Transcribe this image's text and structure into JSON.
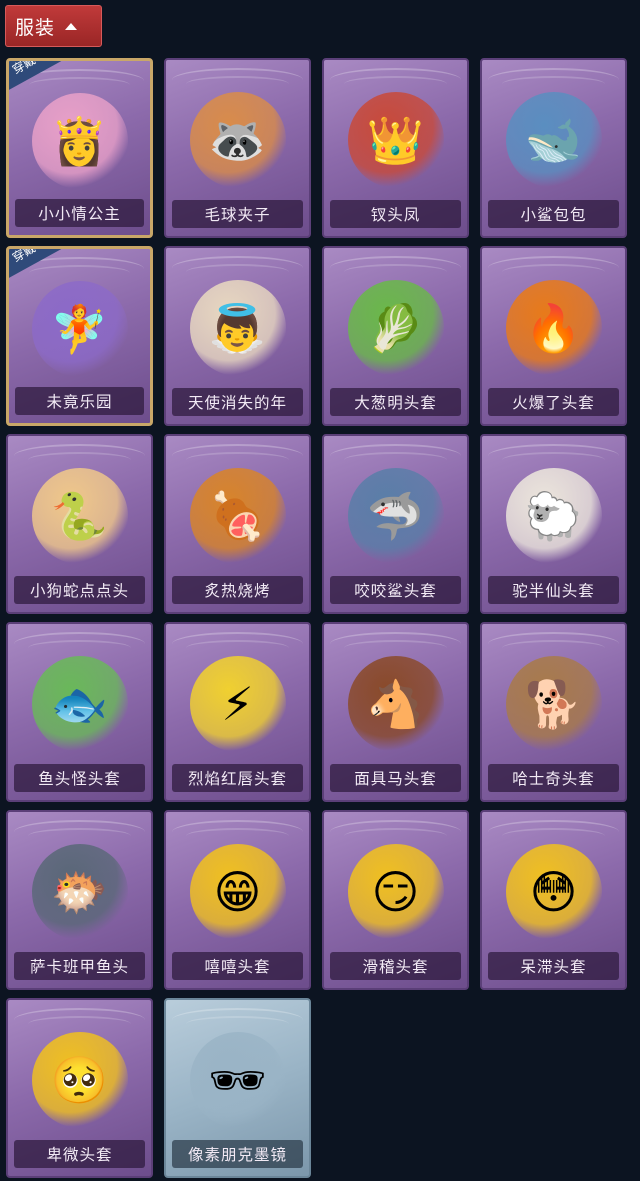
{
  "header": {
    "label": "服装"
  },
  "badge_text": "穿戴",
  "items": [
    {
      "name": "小小情公主",
      "equipped": true,
      "icon": "princess-figure-icon",
      "glyph": "👸",
      "bg": "#e8a0c8",
      "style": "purple"
    },
    {
      "name": "毛球夹子",
      "equipped": false,
      "icon": "raccoon-drummer-icon",
      "glyph": "🦝",
      "bg": "#d98c4a",
      "style": "purple"
    },
    {
      "name": "钗头凤",
      "equipped": false,
      "icon": "phoenix-crown-icon",
      "glyph": "👑",
      "bg": "#c84a3a",
      "style": "purple"
    },
    {
      "name": "小鲨包包",
      "equipped": false,
      "icon": "shark-bag-icon",
      "glyph": "🐋",
      "bg": "#5a8ec0",
      "style": "purple"
    },
    {
      "name": "未竟乐园",
      "equipped": true,
      "icon": "star-girl-figure-icon",
      "glyph": "🧚",
      "bg": "#8c6ac8",
      "style": "purple"
    },
    {
      "name": "天使消失的年",
      "equipped": false,
      "icon": "angel-girl-icon",
      "glyph": "👼",
      "bg": "#e8d8c0",
      "style": "purple"
    },
    {
      "name": "大葱明头套",
      "equipped": false,
      "icon": "scallion-head-icon",
      "glyph": "🥬",
      "bg": "#6ab84a",
      "style": "purple"
    },
    {
      "name": "火爆了头套",
      "equipped": false,
      "icon": "fire-head-icon",
      "glyph": "🔥",
      "bg": "#e87a1a",
      "style": "purple"
    },
    {
      "name": "小狗蛇点点头",
      "equipped": false,
      "icon": "snake-head-icon",
      "glyph": "🐍",
      "bg": "#f0c88a",
      "style": "purple"
    },
    {
      "name": "炙热烧烤",
      "equipped": false,
      "icon": "bbq-meat-icon",
      "glyph": "🍖",
      "bg": "#d8842a",
      "style": "purple"
    },
    {
      "name": "咬咬鲨头套",
      "equipped": false,
      "icon": "shark-head-icon",
      "glyph": "🦈",
      "bg": "#5a7ea8",
      "style": "purple"
    },
    {
      "name": "驼半仙头套",
      "equipped": false,
      "icon": "alpaca-head-icon",
      "glyph": "🐑",
      "bg": "#ece6dc",
      "style": "purple"
    },
    {
      "name": "鱼头怪头套",
      "equipped": false,
      "icon": "fish-head-icon",
      "glyph": "🐟",
      "bg": "#6ab85a",
      "style": "purple"
    },
    {
      "name": "烈焰红唇头套",
      "equipped": false,
      "icon": "pikachu-head-icon",
      "glyph": "⚡",
      "bg": "#f0d030",
      "style": "purple"
    },
    {
      "name": "面具马头套",
      "equipped": false,
      "icon": "horse-head-icon",
      "glyph": "🐴",
      "bg": "#8a4a2a",
      "style": "purple"
    },
    {
      "name": "哈士奇头套",
      "equipped": false,
      "icon": "husky-head-icon",
      "glyph": "🐕",
      "bg": "#a87a4a",
      "style": "purple"
    },
    {
      "name": "萨卡班甲鱼头",
      "equipped": false,
      "icon": "sacabambaspis-head-icon",
      "glyph": "🐡",
      "bg": "#5a6878",
      "style": "purple"
    },
    {
      "name": "嘻嘻头套",
      "equipped": false,
      "icon": "grin-face-icon",
      "glyph": "😁",
      "bg": "#f0c020",
      "style": "purple"
    },
    {
      "name": "滑稽头套",
      "equipped": false,
      "icon": "funny-face-icon",
      "glyph": "😏",
      "bg": "#f0c020",
      "style": "purple"
    },
    {
      "name": "呆滞头套",
      "equipped": false,
      "icon": "dazed-face-icon",
      "glyph": "😳",
      "bg": "#f0c020",
      "style": "purple"
    },
    {
      "name": "卑微头套",
      "equipped": false,
      "icon": "humble-face-icon",
      "glyph": "🥺",
      "bg": "#f0c020",
      "style": "purple"
    },
    {
      "name": "像素朋克墨镜",
      "equipped": false,
      "icon": "pixel-sunglasses-icon",
      "glyph": "🕶",
      "bg": "#9ab4c6",
      "style": "light"
    }
  ]
}
